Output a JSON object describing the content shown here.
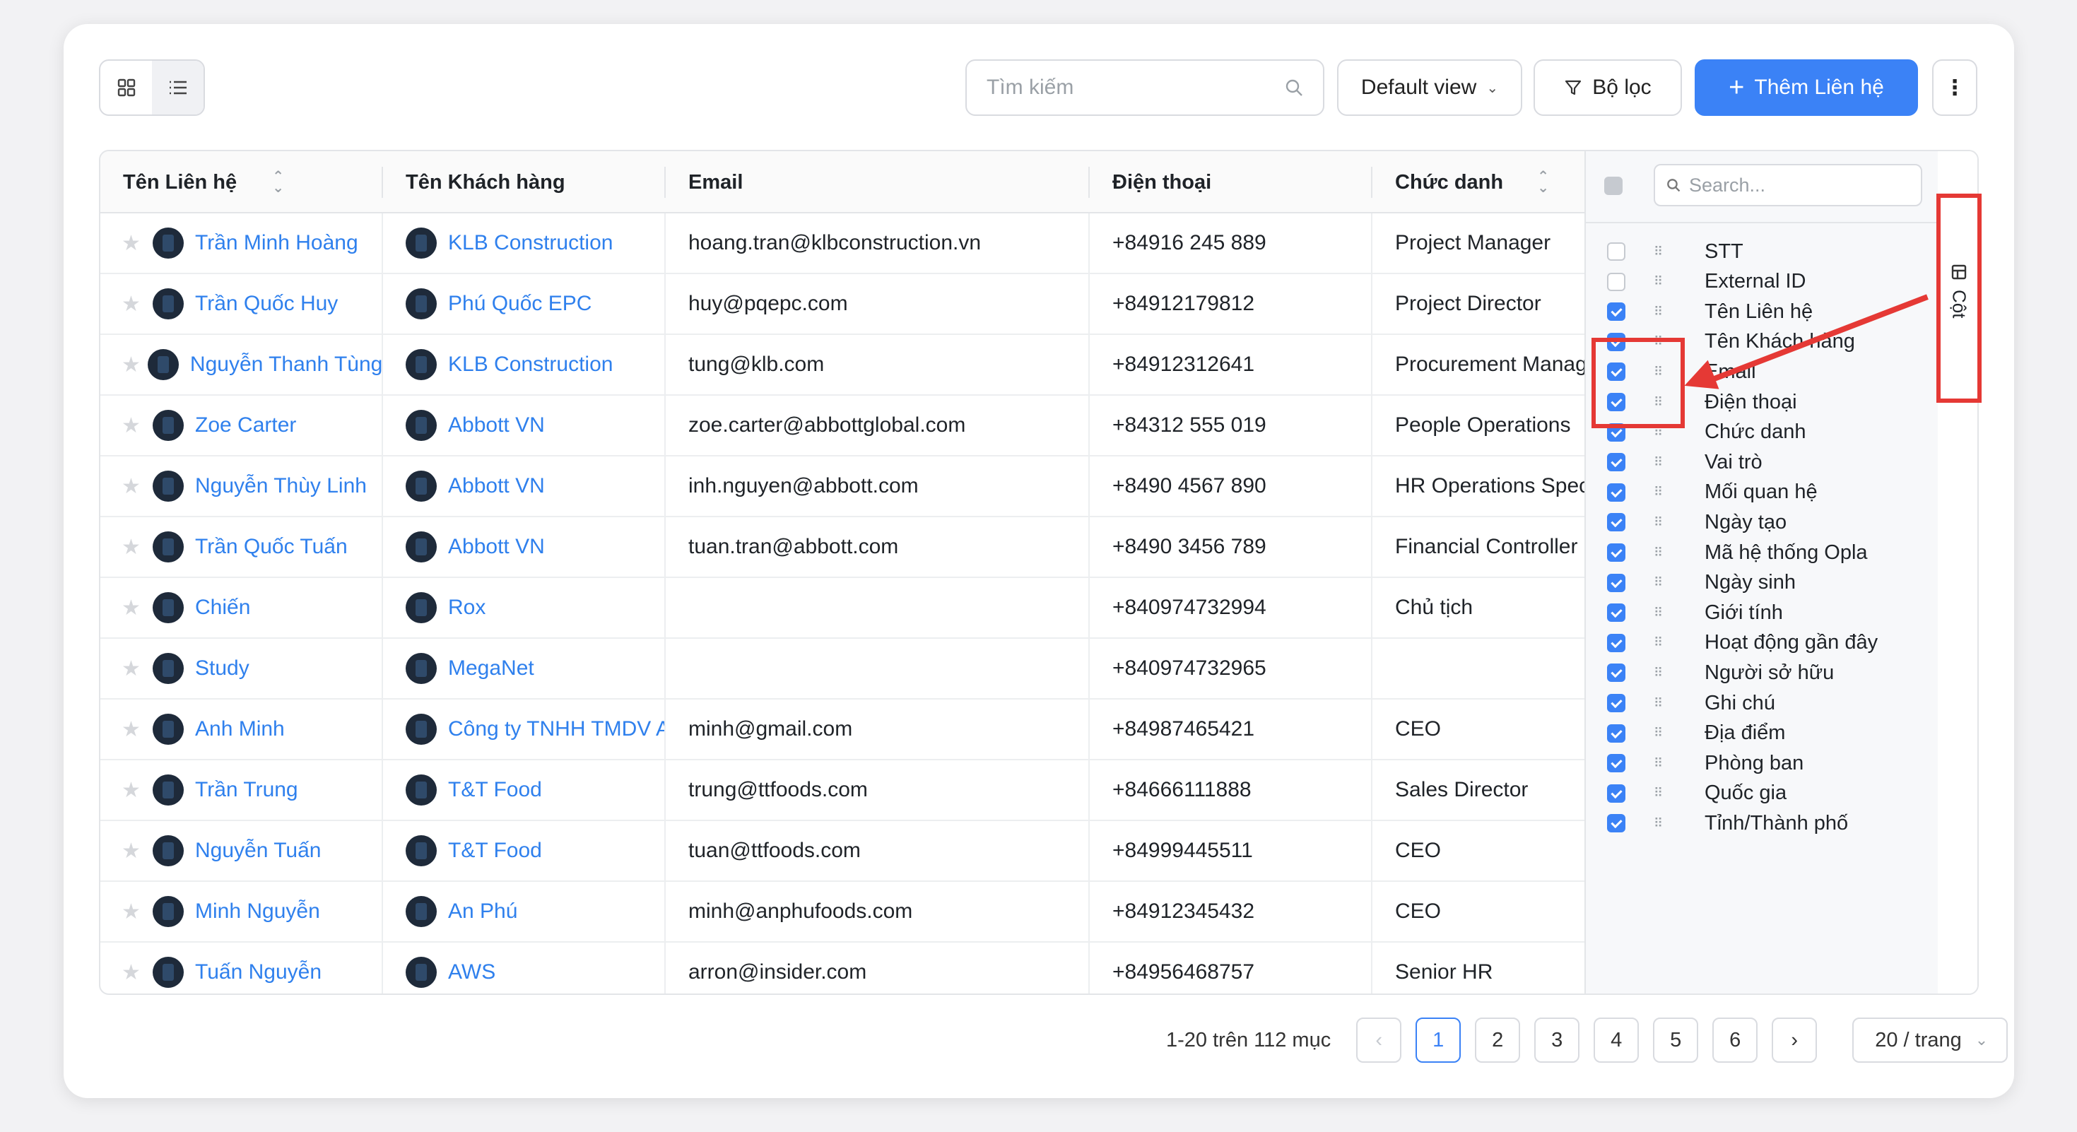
{
  "toolbar": {
    "search_placeholder": "Tìm kiếm",
    "view_select": "Default view",
    "filter_label": "Bộ lọc",
    "add_label": "Thêm Liên hệ",
    "more_icon": "⋮"
  },
  "table": {
    "columns": [
      "Tên Liên hệ",
      "Tên Khách hàng",
      "Email",
      "Điện thoại",
      "Chức danh"
    ],
    "rows": [
      {
        "name": "Trần Minh Hoàng",
        "customer": "KLB Construction",
        "email": "hoang.tran@klbconstruction.vn",
        "phone": "+84916 245 889",
        "title": "Project Manager"
      },
      {
        "name": "Trần Quốc Huy",
        "customer": "Phú Quốc EPC",
        "email": "huy@pqepc.com",
        "phone": "+84912179812",
        "title": "Project Director"
      },
      {
        "name": "Nguyễn Thanh Tùng",
        "customer": "KLB Construction",
        "email": "tung@klb.com",
        "phone": "+84912312641",
        "title": "Procurement Manager"
      },
      {
        "name": "Zoe Carter",
        "customer": "Abbott VN",
        "email": "zoe.carter@abbottglobal.com",
        "phone": "+84312 555 019",
        "title": "People Operations"
      },
      {
        "name": "Nguyễn Thùy Linh",
        "customer": "Abbott VN",
        "email": "inh.nguyen@abbott.com",
        "phone": "+8490 4567 890",
        "title": "HR Operations Specialist"
      },
      {
        "name": "Trần Quốc Tuấn",
        "customer": "Abbott VN",
        "email": "tuan.tran@abbott.com",
        "phone": "+8490 3456 789",
        "title": "Financial Controller"
      },
      {
        "name": "Chiến",
        "customer": "Rox",
        "email": "",
        "phone": "+840974732994",
        "title": "Chủ tịch"
      },
      {
        "name": "Study",
        "customer": "MegaNet",
        "email": "",
        "phone": "+840974732965",
        "title": ""
      },
      {
        "name": "Anh Minh",
        "customer": "Công ty TNHH TMDV A",
        "email": "minh@gmail.com",
        "phone": "+84987465421",
        "title": "CEO"
      },
      {
        "name": "Trần Trung",
        "customer": "T&T Food",
        "email": "trung@ttfoods.com",
        "phone": "+84666111888",
        "title": "Sales Director"
      },
      {
        "name": "Nguyễn Tuấn",
        "customer": "T&T Food",
        "email": "tuan@ttfoods.com",
        "phone": "+84999445511",
        "title": "CEO"
      },
      {
        "name": "Minh Nguyễn",
        "customer": "An Phú",
        "email": "minh@anphufoods.com",
        "phone": "+84912345432",
        "title": "CEO"
      },
      {
        "name": "Tuấn Nguyễn",
        "customer": "AWS",
        "email": "arron@insider.com",
        "phone": "+84956468757",
        "title": "Senior HR"
      }
    ]
  },
  "column_panel": {
    "search_placeholder": "Search...",
    "tab_label": "Cột",
    "items": [
      {
        "label": "STT",
        "checked": false
      },
      {
        "label": "External ID",
        "checked": false
      },
      {
        "label": "Tên Liên hệ",
        "checked": true
      },
      {
        "label": "Tên Khách hàng",
        "checked": true
      },
      {
        "label": "Email",
        "checked": true
      },
      {
        "label": "Điện thoại",
        "checked": true
      },
      {
        "label": "Chức danh",
        "checked": true
      },
      {
        "label": "Vai trò",
        "checked": true
      },
      {
        "label": "Mối quan hệ",
        "checked": true
      },
      {
        "label": "Ngày tạo",
        "checked": true
      },
      {
        "label": "Mã hệ thống Opla",
        "checked": true
      },
      {
        "label": "Ngày sinh",
        "checked": true
      },
      {
        "label": "Giới tính",
        "checked": true
      },
      {
        "label": "Hoạt động gần đây",
        "checked": true
      },
      {
        "label": "Người sở hữu",
        "checked": true
      },
      {
        "label": "Ghi chú",
        "checked": true
      },
      {
        "label": "Địa điểm",
        "checked": true
      },
      {
        "label": "Phòng ban",
        "checked": true
      },
      {
        "label": "Quốc gia",
        "checked": true
      },
      {
        "label": "Tỉnh/Thành phố",
        "checked": true
      }
    ]
  },
  "pagination": {
    "info": "1-20 trên 112 mục",
    "pages": [
      "1",
      "2",
      "3",
      "4",
      "5",
      "6"
    ],
    "current": "1",
    "prev": "‹",
    "next": "›",
    "per_page": "20 / trang"
  },
  "colors": {
    "accent": "#3b82f6",
    "link": "#2f80ed",
    "annotation": "#e53935"
  }
}
